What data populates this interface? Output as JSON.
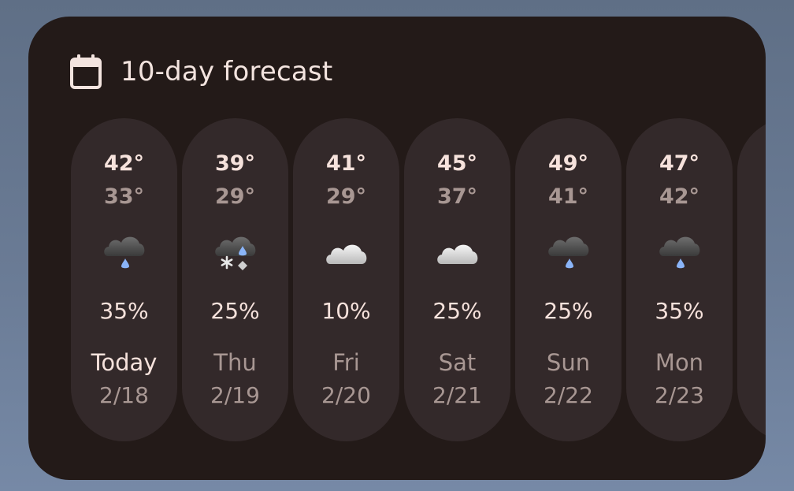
{
  "header": {
    "title": "10-day forecast",
    "icon": "calendar-icon"
  },
  "colors": {
    "card_background": "#231a18",
    "pill_background": "#33292a",
    "primary_text": "#f6e2dc",
    "secondary_text": "#a89793",
    "rain_drop": "#8ab4f8"
  },
  "days": [
    {
      "high": "42°",
      "low": "33°",
      "condition_icon": "rain-icon",
      "precip": "35%",
      "day": "Today",
      "date": "2/18",
      "is_today": true
    },
    {
      "high": "39°",
      "low": "29°",
      "condition_icon": "rain-snow-icon",
      "precip": "25%",
      "day": "Thu",
      "date": "2/19",
      "is_today": false
    },
    {
      "high": "41°",
      "low": "29°",
      "condition_icon": "cloudy-icon",
      "precip": "10%",
      "day": "Fri",
      "date": "2/20",
      "is_today": false
    },
    {
      "high": "45°",
      "low": "37°",
      "condition_icon": "cloudy-icon",
      "precip": "25%",
      "day": "Sat",
      "date": "2/21",
      "is_today": false
    },
    {
      "high": "49°",
      "low": "41°",
      "condition_icon": "rain-icon",
      "precip": "25%",
      "day": "Sun",
      "date": "2/22",
      "is_today": false
    },
    {
      "high": "47°",
      "low": "42°",
      "condition_icon": "rain-icon",
      "precip": "35%",
      "day": "Mon",
      "date": "2/23",
      "is_today": false
    }
  ]
}
